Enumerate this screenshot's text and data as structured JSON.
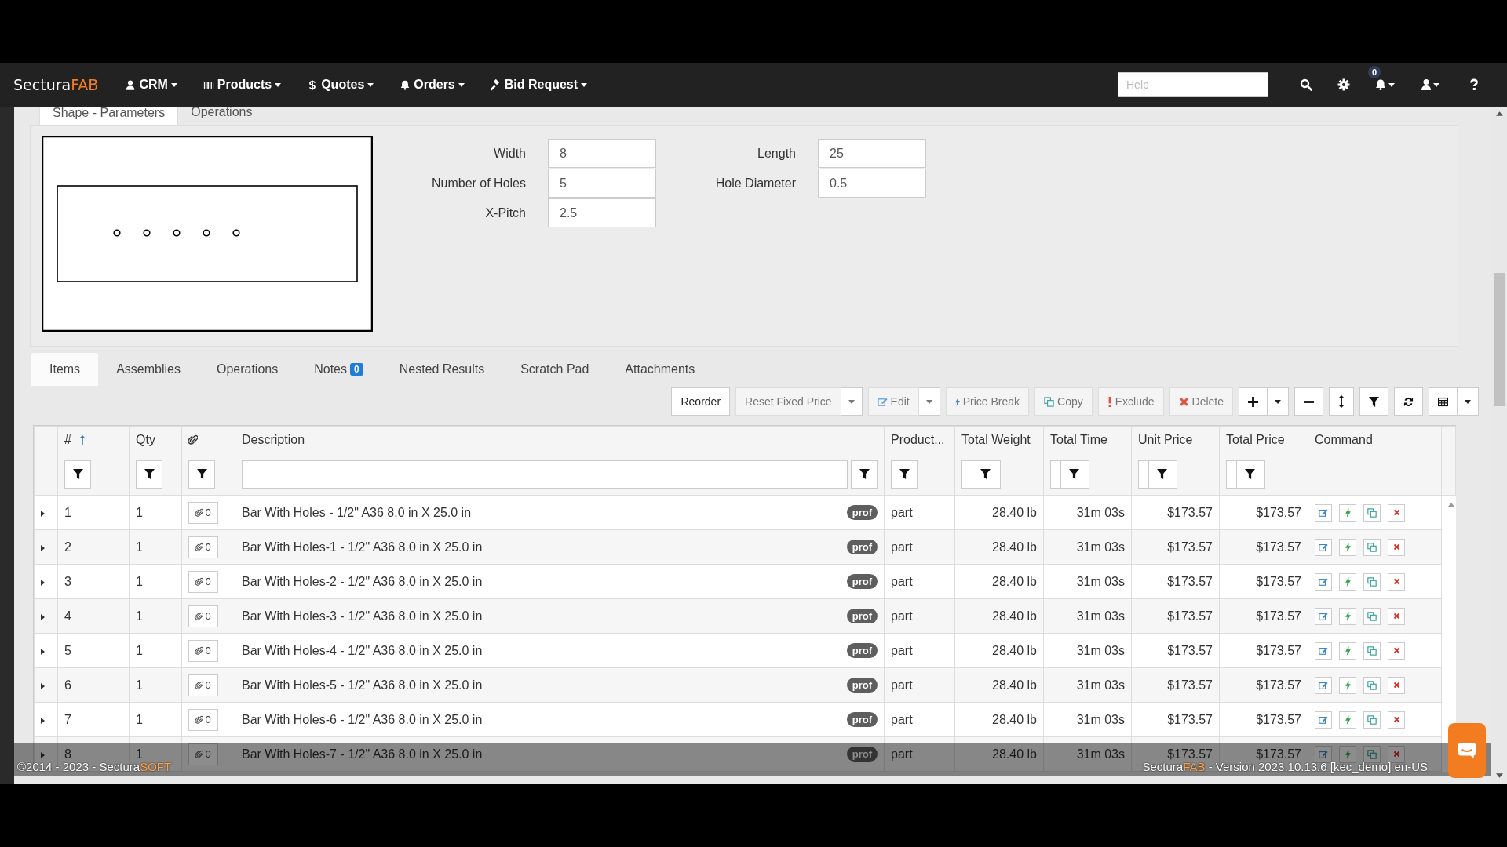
{
  "navbar": {
    "brand": {
      "first": "Sectura",
      "second": "FAB"
    },
    "menus": [
      {
        "kind": "user",
        "label": "CRM"
      },
      {
        "kind": "barcode",
        "label": "Products"
      },
      {
        "kind": "dollar",
        "label": "Quotes"
      },
      {
        "kind": "bell",
        "label": "Orders"
      },
      {
        "kind": "gavel",
        "label": "Bid Request"
      }
    ],
    "help": {
      "placeholder": "Help"
    },
    "notifications": "0"
  },
  "shape_tabs": [
    {
      "label": "Shape - Parameters",
      "selected": true
    },
    {
      "label": "Operations",
      "selected": false
    }
  ],
  "parameters": [
    {
      "label": "Width",
      "value": "8"
    },
    {
      "label": "Length",
      "value": "25"
    },
    {
      "label": "Number of Holes",
      "value": "5"
    },
    {
      "label": "Hole Diameter",
      "value": "0.5"
    },
    {
      "label": "X-Pitch",
      "value": "2.5"
    }
  ],
  "item_tabs": [
    {
      "label": "Items",
      "selected": true
    },
    {
      "label": "Assemblies",
      "selected": false
    },
    {
      "label": "Operations",
      "selected": false
    },
    {
      "label": "Notes",
      "selected": false,
      "badge": "0"
    },
    {
      "label": "Nested Results",
      "selected": false
    },
    {
      "label": "Scratch Pad",
      "selected": false
    },
    {
      "label": "Attachments",
      "selected": false
    }
  ],
  "toolbar": [
    {
      "kind": "text",
      "label": "Reorder",
      "disabled": false,
      "caret": false
    },
    {
      "kind": "text",
      "label": "Reset Fixed Price",
      "disabled": true,
      "caret": true
    },
    {
      "kind": "edit",
      "label": "Edit",
      "disabled": true,
      "caret": true
    },
    {
      "kind": "bolt",
      "label": "Price Break",
      "disabled": true,
      "caret": false
    },
    {
      "kind": "copy",
      "label": "Copy",
      "disabled": true,
      "caret": false
    },
    {
      "kind": "exclude",
      "label": "Exclude",
      "disabled": true,
      "caret": false
    },
    {
      "kind": "delete",
      "label": "Delete",
      "disabled": true,
      "caret": false
    },
    {
      "kind": "add",
      "disabled": false,
      "caret": true
    },
    {
      "kind": "remove",
      "disabled": false,
      "caret": false
    },
    {
      "kind": "resize",
      "disabled": false,
      "caret": false
    },
    {
      "kind": "filter",
      "disabled": false,
      "caret": false
    },
    {
      "kind": "refresh",
      "disabled": false,
      "caret": false
    },
    {
      "kind": "columns",
      "disabled": false,
      "caret": true
    }
  ],
  "table": {
    "columns": [
      {
        "kind": "plain",
        "label": "#",
        "sorted": true
      },
      {
        "kind": "plain",
        "label": "Qty",
        "sorted": false
      },
      {
        "kind": "attachment",
        "sorted": false
      },
      {
        "kind": "text",
        "label": "Description",
        "sorted": false
      },
      {
        "kind": "plain",
        "label": "Product...",
        "sorted": false
      },
      {
        "kind": "measure",
        "label": "Total Weight",
        "sorted": false
      },
      {
        "kind": "measure",
        "label": "Total Time",
        "sorted": false
      },
      {
        "kind": "measure",
        "label": "Unit Price",
        "sorted": false
      },
      {
        "kind": "measure",
        "label": "Total Price",
        "sorted": false
      },
      {
        "kind": "command",
        "label": "Command",
        "sorted": false
      }
    ],
    "rows": [
      {
        "num": "1",
        "qty": "1",
        "attachments": "0",
        "description": "Bar With Holes - 1/2\" A36 8.0 in X 25.0 in",
        "tag": "prof",
        "product": "part",
        "weight": "28.40 lb",
        "time": "31m 03s",
        "unit_price": "$173.57",
        "total_price": "$173.57"
      },
      {
        "num": "2",
        "qty": "1",
        "attachments": "0",
        "description": "Bar With Holes-1 - 1/2\" A36 8.0 in X 25.0 in",
        "tag": "prof",
        "product": "part",
        "weight": "28.40 lb",
        "time": "31m 03s",
        "unit_price": "$173.57",
        "total_price": "$173.57"
      },
      {
        "num": "3",
        "qty": "1",
        "attachments": "0",
        "description": "Bar With Holes-2 - 1/2\" A36 8.0 in X 25.0 in",
        "tag": "prof",
        "product": "part",
        "weight": "28.40 lb",
        "time": "31m 03s",
        "unit_price": "$173.57",
        "total_price": "$173.57"
      },
      {
        "num": "4",
        "qty": "1",
        "attachments": "0",
        "description": "Bar With Holes-3 - 1/2\" A36 8.0 in X 25.0 in",
        "tag": "prof",
        "product": "part",
        "weight": "28.40 lb",
        "time": "31m 03s",
        "unit_price": "$173.57",
        "total_price": "$173.57"
      },
      {
        "num": "5",
        "qty": "1",
        "attachments": "0",
        "description": "Bar With Holes-4 - 1/2\" A36 8.0 in X 25.0 in",
        "tag": "prof",
        "product": "part",
        "weight": "28.40 lb",
        "time": "31m 03s",
        "unit_price": "$173.57",
        "total_price": "$173.57"
      },
      {
        "num": "6",
        "qty": "1",
        "attachments": "0",
        "description": "Bar With Holes-5 - 1/2\" A36 8.0 in X 25.0 in",
        "tag": "prof",
        "product": "part",
        "weight": "28.40 lb",
        "time": "31m 03s",
        "unit_price": "$173.57",
        "total_price": "$173.57"
      },
      {
        "num": "7",
        "qty": "1",
        "attachments": "0",
        "description": "Bar With Holes-6 - 1/2\" A36 8.0 in X 25.0 in",
        "tag": "prof",
        "product": "part",
        "weight": "28.40 lb",
        "time": "31m 03s",
        "unit_price": "$173.57",
        "total_price": "$173.57"
      },
      {
        "num": "8",
        "qty": "1",
        "attachments": "0",
        "description": "Bar With Holes-7 - 1/2\" A36 8.0 in X 25.0 in",
        "tag": "prof",
        "product": "part",
        "weight": "28.40 lb",
        "time": "31m 03s",
        "unit_price": "$173.57",
        "total_price": "$173.57"
      }
    ]
  },
  "footer": {
    "copyright": "©2014 - 2023 - Sectura",
    "copyright_accent": "SOFT",
    "brand": "Sectura",
    "brand_accent": "FAB",
    "version": " - Version 2023.10.13.6 [kec_demo] en-US"
  }
}
